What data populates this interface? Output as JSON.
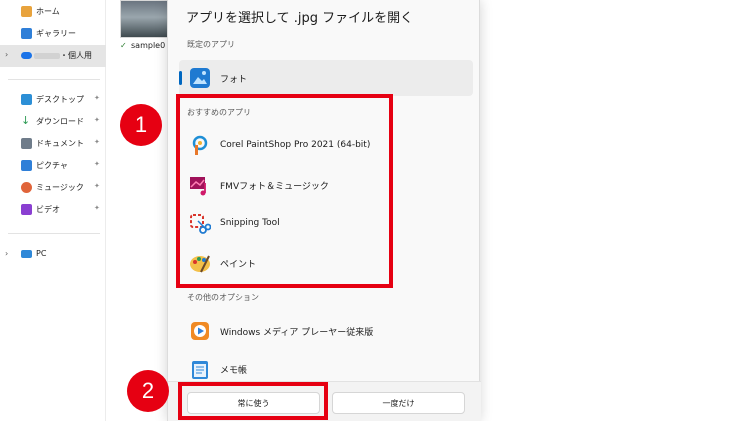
{
  "sidebar": {
    "items": [
      {
        "label": "ホーム",
        "icon": "home-icon",
        "color": "#e8a33d"
      },
      {
        "label": "ギャラリー",
        "icon": "gallery-icon",
        "color": "#2f7fd8"
      },
      {
        "label": "・個人用",
        "icon": "onedrive-icon",
        "color": "#1a73e8"
      },
      {
        "label": "デスクトップ",
        "icon": "desktop-icon",
        "color": "#2c8fd6"
      },
      {
        "label": "ダウンロード",
        "icon": "download-icon",
        "color": "#2e9b55"
      },
      {
        "label": "ドキュメント",
        "icon": "documents-icon",
        "color": "#6f7c8a"
      },
      {
        "label": "ピクチャ",
        "icon": "pictures-icon",
        "color": "#2f7fd8"
      },
      {
        "label": "ミュージック",
        "icon": "music-icon",
        "color": "#e0643a"
      },
      {
        "label": "ビデオ",
        "icon": "videos-icon",
        "color": "#8a3fd1"
      },
      {
        "label": "PC",
        "icon": "pc-icon",
        "color": "#2f88d8"
      }
    ]
  },
  "explorer": {
    "file_label": "sample0"
  },
  "dialog": {
    "title": "アプリを選択して .jpg ファイルを開く",
    "sections": {
      "default": "既定のアプリ",
      "recommended": "おすすめのアプリ",
      "other": "その他のオプション"
    },
    "apps": [
      {
        "name": "フォト",
        "icon": "photos-icon"
      },
      {
        "name": "Corel PaintShop Pro 2021 (64-bit)",
        "icon": "paintshop-icon"
      },
      {
        "name": "FMVフォト＆ミュージック",
        "icon": "fmv-photo-music-icon"
      },
      {
        "name": "Snipping Tool",
        "icon": "snipping-tool-icon"
      },
      {
        "name": "ペイント",
        "icon": "paint-icon"
      },
      {
        "name": "Windows メディア プレーヤー従来版",
        "icon": "windows-media-player-icon"
      },
      {
        "name": "メモ帳",
        "icon": "notepad-icon"
      }
    ],
    "buttons": {
      "always": "常に使う",
      "once": "一度だけ"
    }
  },
  "annotations": {
    "badge1": "1",
    "badge2": "2",
    "highlight_color": "#e60012"
  }
}
